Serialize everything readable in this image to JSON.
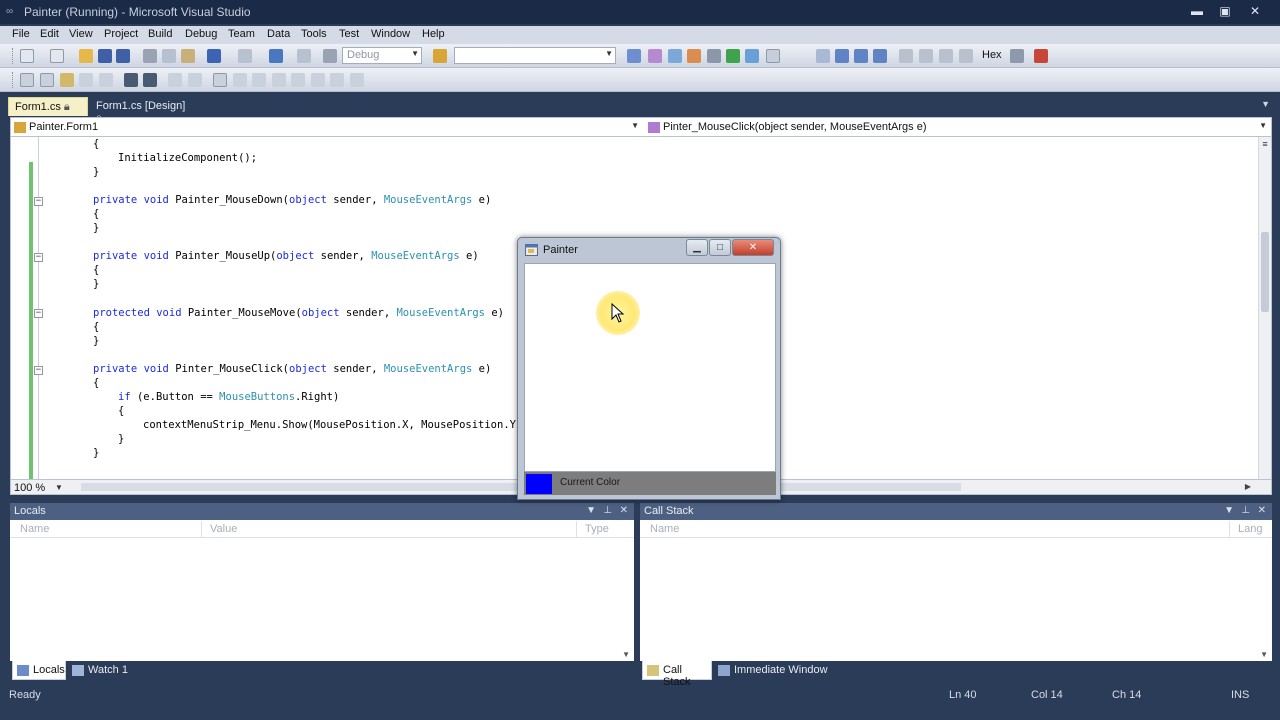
{
  "window": {
    "title": "Painter (Running) - Microsoft Visual Studio",
    "minimize_glyph": "▬",
    "maximize_glyph": "▣",
    "close_glyph": "✕"
  },
  "menu": [
    "File",
    "Edit",
    "View",
    "Project",
    "Build",
    "Debug",
    "Team",
    "Data",
    "Tools",
    "Test",
    "Window",
    "Help"
  ],
  "toolbar": {
    "config_value": "Debug",
    "find_value": "",
    "hex_label": "Hex"
  },
  "tabs": [
    {
      "label": "Form1.cs",
      "active": true
    },
    {
      "label": "Form1.cs [Design]",
      "active": false
    }
  ],
  "navbar": {
    "type_combo": "Painter.Form1",
    "member_combo": "Pinter_MouseClick(object sender, MouseEventArgs e)"
  },
  "zoom": "100 %",
  "painter_form": {
    "title": "Painter",
    "status_label": "Current Color",
    "current_color": "#0000ff"
  },
  "locals": {
    "title": "Locals",
    "columns": [
      "Name",
      "Value",
      "Type"
    ]
  },
  "callstack": {
    "title": "Call Stack",
    "columns": [
      "Name",
      "Lang"
    ]
  },
  "bottom_tabs_left": [
    {
      "label": "Locals",
      "active": true,
      "icon": "locals-icon"
    },
    {
      "label": "Watch 1",
      "active": false,
      "icon": "watch-icon"
    }
  ],
  "bottom_tabs_right": [
    {
      "label": "Call Stack",
      "active": true,
      "icon": "callstack-icon"
    },
    {
      "label": "Immediate Window",
      "active": false,
      "icon": "immediate-icon"
    }
  ],
  "status": {
    "state": "Ready",
    "line": "Ln 40",
    "col": "Col 14",
    "ch": "Ch 14",
    "mode": "INS"
  },
  "colors": {
    "chrome_dark": "#2b3c59",
    "active_tab": "#f6f0c8",
    "change_bar": "#6fc36f",
    "keyword": "#1a2be0",
    "type_name": "#2b91af"
  }
}
